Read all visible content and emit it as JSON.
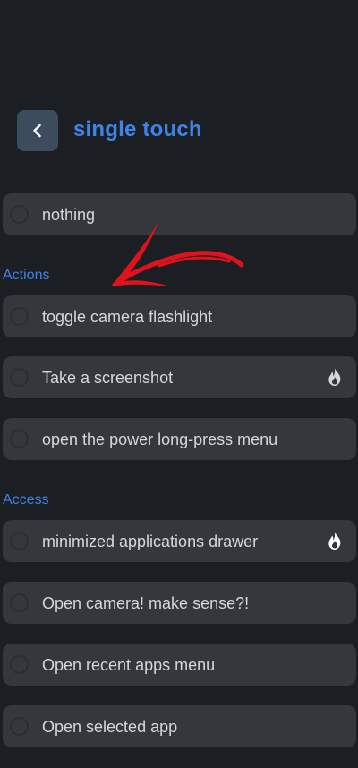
{
  "header": {
    "title": "single touch",
    "back_icon": "chevron-left-icon"
  },
  "options_top": [
    {
      "label": "nothing"
    }
  ],
  "sections": [
    {
      "title": "Actions",
      "items": [
        {
          "label": "toggle camera flashlight",
          "icon": ""
        },
        {
          "label": "Take a screenshot",
          "icon": "fire-icon"
        },
        {
          "label": "open the power long-press menu",
          "icon": ""
        }
      ]
    },
    {
      "title": "Access",
      "items": [
        {
          "label": "minimized applications drawer",
          "icon": "fire-icon"
        },
        {
          "label": "Open camera! make sense?!",
          "icon": ""
        },
        {
          "label": "Open recent apps menu",
          "icon": ""
        },
        {
          "label": "Open selected app",
          "icon": ""
        }
      ]
    }
  ],
  "annotation": {
    "arrow_color": "#e0131d"
  },
  "colors": {
    "background": "#1b1e22",
    "card": "#34373c",
    "accent": "#3d84e6",
    "back_button": "#3c4c5c"
  }
}
